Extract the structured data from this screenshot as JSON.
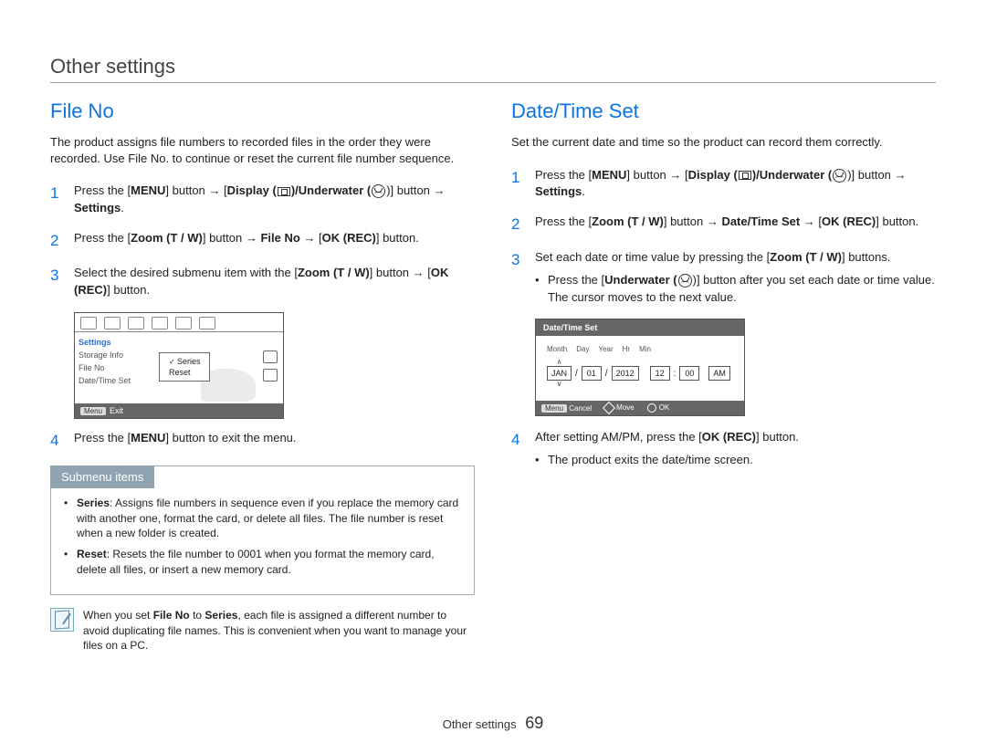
{
  "page_title": "Other settings",
  "footer": {
    "section": "Other settings",
    "page_number": "69"
  },
  "left": {
    "heading": "File No",
    "intro": "The product assigns file numbers to recorded files in the order they were recorded. Use File No. to continue or reset the current file number sequence.",
    "steps": {
      "s1a": "Press the [",
      "s1_menu": "MENU",
      "s1b": "] button → [",
      "s1_display": "Display (",
      "s1_underwater": ")/Underwater (",
      "s1c": ")] button → ",
      "s1_settings": "Settings",
      "s1d": ".",
      "s2a": "Press the [",
      "s2_zoom": "Zoom (T / W)",
      "s2b": "] button → ",
      "s2_fileno": "File No",
      "s2c": " → [",
      "s2_ok": "OK (REC)",
      "s2d": "] button.",
      "s3a": "Select the desired submenu item with the [",
      "s3_zoom": "Zoom (T / W)",
      "s3b": "] button → [",
      "s3_ok": "OK (REC)",
      "s3c": "] button.",
      "s4a": "Press the [",
      "s4_menu": "MENU",
      "s4b": "] button to exit the menu."
    },
    "shot1": {
      "menu_settings": "Settings",
      "menu_storage": "Storage Info",
      "menu_fileno": "File No",
      "menu_datetime": "Date/Time Set",
      "popup_series": "Series",
      "popup_reset": "Reset",
      "foot_menu": "Menu",
      "foot_exit": "Exit"
    },
    "submenu": {
      "title": "Submenu items",
      "series_label": "Series",
      "series_text": ": Assigns file numbers in sequence even if you replace the memory card with another one, format the card, or delete all files. The file number is reset when a new folder is created.",
      "reset_label": "Reset",
      "reset_text": ": Resets the file number to 0001 when you format the memory card, delete all files, or insert a new memory card."
    },
    "note": {
      "t1": "When you set ",
      "t1b": "File No",
      "t2": " to ",
      "t2b": "Series",
      "t3": ", each file is assigned a different number to avoid duplicating file names. This is convenient when you want to manage your files on a PC."
    }
  },
  "right": {
    "heading": "Date/Time Set",
    "intro": "Set the current date and time so the product can record them correctly.",
    "steps": {
      "s1a": "Press the [",
      "s1_menu": "MENU",
      "s1b": "] button → [",
      "s1_display": "Display (",
      "s1_underwater": ")/Underwater (",
      "s1c": ")] button → ",
      "s1_settings": "Settings",
      "s1d": ".",
      "s2a": "Press the [",
      "s2_zoom": "Zoom (T / W)",
      "s2b": "] button → ",
      "s2_dts": "Date/Time Set",
      "s2c": " → [",
      "s2_ok": "OK (REC)",
      "s2d": "] button.",
      "s3a": "Set each date or time value by pressing the [",
      "s3_zoom": "Zoom (T / W)",
      "s3b": "] buttons.",
      "s3_bullet_a": "Press the [",
      "s3_bullet_uw": "Underwater (",
      "s3_bullet_b": ")] button after you set each date or time value. The cursor moves to the next value.",
      "s4a": "After setting AM/PM, press the [",
      "s4_ok": "OK (REC)",
      "s4b": "] button.",
      "s4_bullet": "The product exits the date/time screen."
    },
    "shot2": {
      "title": "Date/Time Set",
      "l_month": "Month",
      "l_day": "Day",
      "l_year": "Year",
      "l_hr": "Hr",
      "l_min": "Min",
      "v_month": "JAN",
      "v_day": "01",
      "v_year": "2012",
      "v_hr": "12",
      "v_min": "00",
      "v_ampm": "AM",
      "foot_menu": "Menu",
      "foot_cancel": "Cancel",
      "foot_move": "Move",
      "foot_ok": "OK"
    }
  }
}
